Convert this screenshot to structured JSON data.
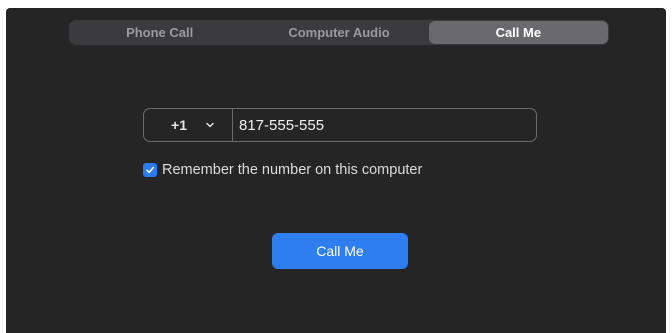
{
  "tabs": [
    {
      "label": "Phone Call",
      "active": false
    },
    {
      "label": "Computer Audio",
      "active": false
    },
    {
      "label": "Call Me",
      "active": true
    }
  ],
  "phone": {
    "country_code": "+1",
    "number": "817-555-555"
  },
  "remember": {
    "checked": true,
    "label": "Remember the number on this computer"
  },
  "call_button": {
    "label": "Call Me"
  },
  "colors": {
    "accent": "#2e7ef0",
    "background": "#252526",
    "tab_bar": "#3b3b3d",
    "tab_active": "#6a6a6c"
  },
  "icons": {
    "country_dropdown": "chevron-down-icon",
    "checkbox": "checkmark-icon"
  }
}
